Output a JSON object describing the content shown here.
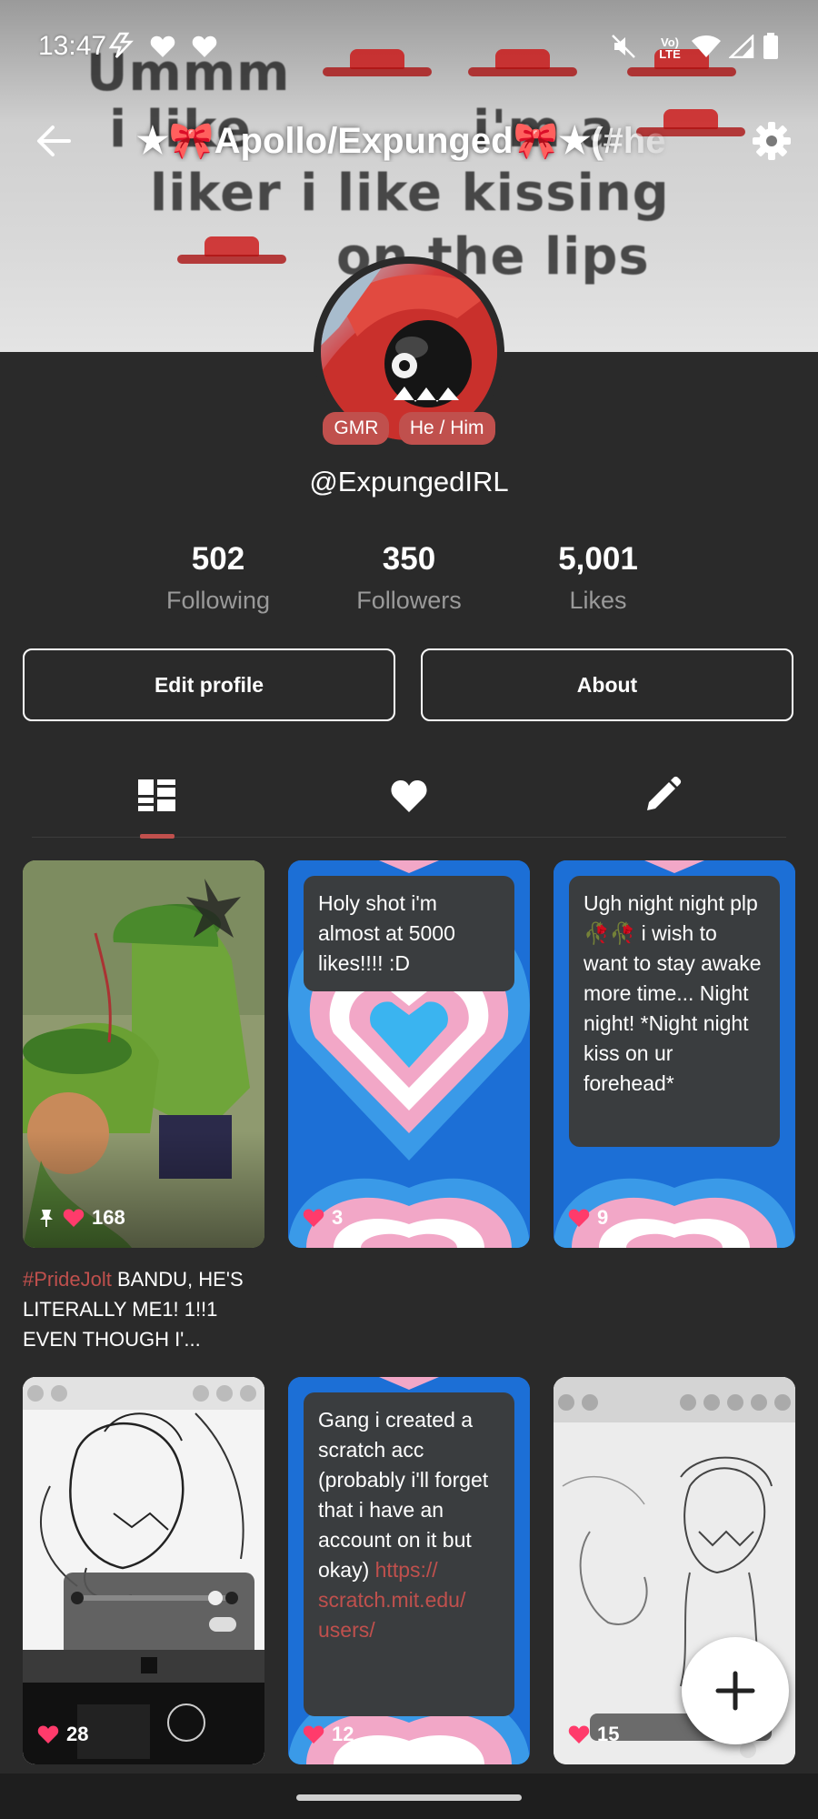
{
  "status_bar": {
    "time": "13:47",
    "network_label": "Vo) LTE"
  },
  "header": {
    "title": "★🎀Apollo/Expunged🎀★(#he",
    "banner_text": [
      "Ummm",
      "i like",
      "i'm a",
      "liker i like kissing",
      "on the lips"
    ]
  },
  "profile": {
    "badges": [
      "GMR",
      "He / Him"
    ],
    "handle": "@ExpungedIRL",
    "stats": [
      {
        "value": "502",
        "label": "Following"
      },
      {
        "value": "350",
        "label": "Followers"
      },
      {
        "value": "5,001",
        "label": "Likes"
      }
    ],
    "buttons": {
      "edit": "Edit profile",
      "about": "About"
    }
  },
  "tabs": [
    "posts-grid-icon",
    "liked-heart-icon",
    "drafts-pencil-icon"
  ],
  "posts": [
    {
      "likes": "168",
      "pinned": true,
      "caption_tag": "#PrideJolt",
      "caption_text": " BANDU, HE'S LITERALLY ME1! 1!!1 EVEN THOUGH I'..."
    },
    {
      "likes": "3",
      "text": "Holy shot i'm almost at 5000 likes!!!! :D"
    },
    {
      "likes": "9",
      "text": "Ugh night night plp🥀🥀 i wish to want to stay awake more time... Night night! *Night night kiss on ur forehead*"
    },
    {
      "likes": "28"
    },
    {
      "likes": "12",
      "text": "Gang i created a scratch acc (probably i'll forget that i have an account on it but okay)",
      "link": "https:// scratch.mit.edu/ users/"
    },
    {
      "likes": "15"
    }
  ],
  "colors": {
    "accent": "#c0504d",
    "background": "#2a2a2a",
    "pride_blue": "#1c71d8",
    "pride_pink": "#f0a0c8"
  }
}
